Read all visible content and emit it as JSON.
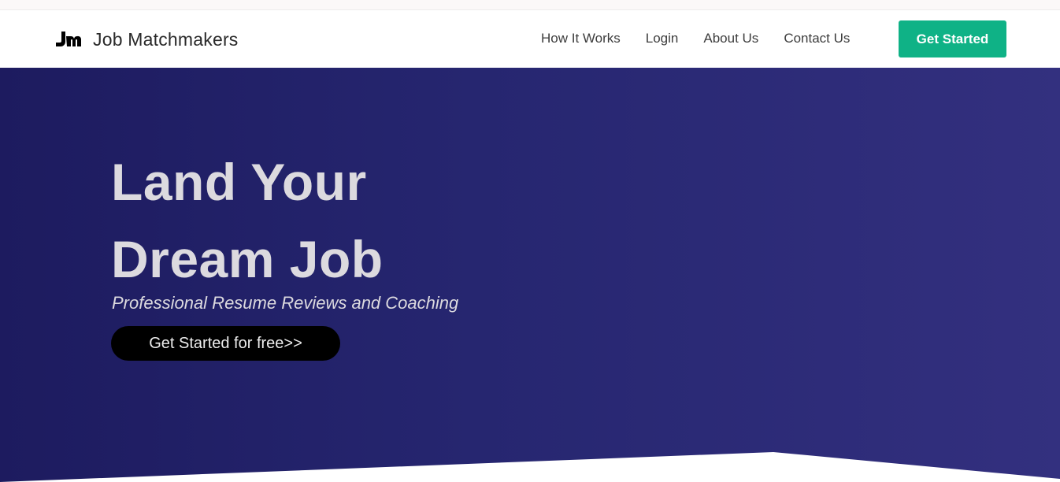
{
  "brand": {
    "logo_icon": "jm-monogram-icon",
    "name": "Job Matchmakers"
  },
  "nav": {
    "links": [
      "How It Works",
      "Login",
      "About Us",
      "Contact Us"
    ],
    "cta_label": "Get Started"
  },
  "hero": {
    "title_line1": "Land Your",
    "title_line2": "Dream Job",
    "subtitle": "Professional Resume Reviews and Coaching",
    "cta_label": "Get Started for free>>"
  },
  "colors": {
    "accent": "#0fb286",
    "hero_start": "#1d1b5f",
    "hero_end": "#33307f",
    "hero_text": "#dcdadf"
  }
}
